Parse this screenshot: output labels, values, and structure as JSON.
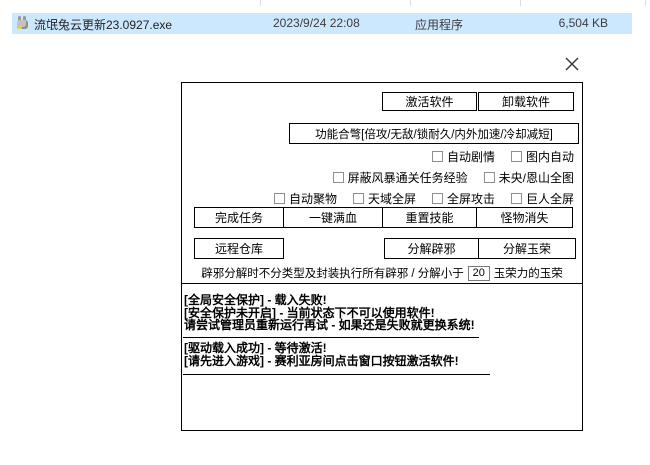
{
  "explorer_row": {
    "file_name": "流氓兔云更新23.0927.exe",
    "date_modified": "2023/9/24 22:08",
    "file_type": "应用程序",
    "file_size": "6,504 KB",
    "selection_color": "#cce8ff"
  },
  "window": {
    "icons": {
      "close": "✕",
      "file": "rabbit-app-icon"
    },
    "top_buttons": {
      "activate": "激活软件",
      "uninstall": "卸载软件"
    },
    "combo_button": "功能合彆[倍攻/无敌/锁耐久/内外加速/冷却减短]",
    "checkbox_rows": [
      {
        "items": [
          {
            "label": "自动剧情"
          },
          {
            "label": "图内自动"
          }
        ]
      },
      {
        "items": [
          {
            "label": "屏蔽风暴通关任务经验"
          },
          {
            "label": "未央/恩山全图"
          }
        ]
      },
      {
        "items": [
          {
            "label": "自动聚物"
          },
          {
            "label": "天域全屏"
          },
          {
            "label": "全屏攻击"
          },
          {
            "label": "巨人全屏"
          }
        ]
      }
    ],
    "action_row1": [
      "完成任务",
      "一键满血",
      "重置技能",
      "怪物消失"
    ],
    "action_row2": {
      "remote": "远程仓库",
      "decompose_pixie": "分解辟邪",
      "decompose_yurong": "分解玉荣"
    },
    "decompose_line": {
      "prefix": "辟邪分解时不分类型及封装执行所有辟邪 / 分解小于",
      "value": "20",
      "suffix": "玉荣力的玉荣"
    },
    "log_section1": [
      "[全局安全保护] - 载入失败!",
      "[安全保护未开启] - 当前状态下不可以使用软件!",
      "请尝试管理员重新运行再试 - 如果还是失败就更换系统!"
    ],
    "log_section2": [
      "[驱动载入成功] - 等待激活!",
      "[请先进入游戏] - 赛利亚房间点击窗口按钮激活软件!"
    ],
    "border_color": "#000000"
  }
}
